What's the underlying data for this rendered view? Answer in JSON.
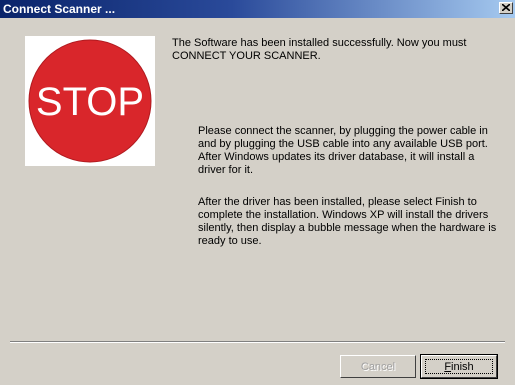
{
  "window": {
    "title": "Connect Scanner ...",
    "close_glyph": "×"
  },
  "stop_sign": {
    "text": "STOP",
    "color": "#d9262b"
  },
  "message": {
    "intro": "The Software has been installed successfully.  Now you must CONNECT YOUR SCANNER.",
    "para1": "Please connect the scanner, by plugging the power cable in and by plugging the USB cable into any available USB port. After Windows updates its driver database, it will install a driver for it.",
    "para2": "After the driver has been installed, please select Finish to complete the installation.  Windows XP will install the drivers silently, then display a bubble message when the hardware is ready to use."
  },
  "buttons": {
    "cancel_label": "Cancel",
    "cancel_enabled": false,
    "finish_label": "Finish"
  },
  "colors": {
    "title_active": "#0a246a",
    "face": "#d4d0c8"
  }
}
